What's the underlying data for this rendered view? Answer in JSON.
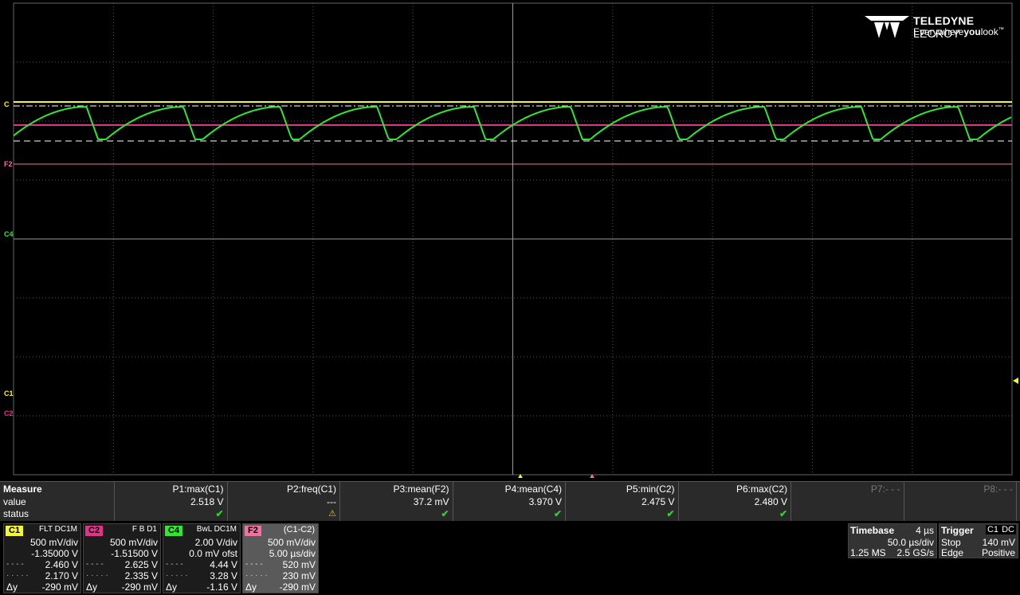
{
  "logo": {
    "brand_bold": "TELEDYNE",
    "brand_light": " LECROY",
    "tagline_a": "Everywhere",
    "tagline_b": "you",
    "tagline_c": "look",
    "tm": "™"
  },
  "markers": {
    "f2": "F2",
    "c4": "C4",
    "c1": "C1",
    "c2": "C2",
    "c_top": "C"
  },
  "colors": {
    "c1": "#f6f639",
    "c2": "#e0338a",
    "c4": "#34e534",
    "f2": "#f36fa4",
    "grid": "#7a7a7a"
  },
  "measure": {
    "title": "Measure",
    "row_value": "value",
    "row_status": "status",
    "params": [
      {
        "name": "P1:max(C1)",
        "value": "2.518 V",
        "status": "✔"
      },
      {
        "name": "P2:freq(C1)",
        "value": "---",
        "status": "⚠"
      },
      {
        "name": "P3:mean(F2)",
        "value": "37.2 mV",
        "status": "✔"
      },
      {
        "name": "P4:mean(C4)",
        "value": "3.970 V",
        "status": "✔"
      },
      {
        "name": "P5:min(C2)",
        "value": "2.475 V",
        "status": "✔"
      },
      {
        "name": "P6:max(C2)",
        "value": "2.480 V",
        "status": "✔"
      },
      {
        "name": "P7:- - -",
        "value": "",
        "status": ""
      },
      {
        "name": "P8:- - -",
        "value": "",
        "status": ""
      }
    ]
  },
  "channels": {
    "c1": {
      "tag": "C1",
      "coupling": "FLT  DC1M",
      "scale": "500 mV/div",
      "offset": "-1.35000 V",
      "cur_a": "2.460 V",
      "cur_b": "2.170 V",
      "delta": "-290 mV"
    },
    "c2": {
      "tag": "C2",
      "coupling": "F  B  D1",
      "scale": "500 mV/div",
      "offset": "-1.51500 V",
      "cur_a": "2.625 V",
      "cur_b": "2.335 V",
      "delta": "-290 mV"
    },
    "c4": {
      "tag": "C4",
      "coupling": "BwL  DC1M",
      "scale": "2.00 V/div",
      "offset": "0.0 mV ofst",
      "cur_a": "4.44 V",
      "cur_b": "3.28 V",
      "delta": "-1.16 V"
    },
    "f2": {
      "tag": "F2",
      "coupling": "(C1-C2)",
      "scale": "500 mV/div",
      "offset": "5.00 µs/div",
      "cur_a": "520 mV",
      "cur_b": "230 mV",
      "delta": "-290 mV"
    }
  },
  "cursor_keys": {
    "a": "- - - -",
    "b": "· · · · ·",
    "delta": "Δy"
  },
  "timebase": {
    "title": "Timebase",
    "delay": "4 µs",
    "per_div": "50.0 µs/div",
    "samples": "1.25 MS",
    "rate": "2.5 GS/s"
  },
  "trigger": {
    "title": "Trigger",
    "source": "C1",
    "coupling": "DC",
    "mode": "Stop",
    "level": "140 mV",
    "type": "Edge",
    "slope": "Positive"
  },
  "waveform": {
    "period_us": 24,
    "visible_cycles": 10
  }
}
